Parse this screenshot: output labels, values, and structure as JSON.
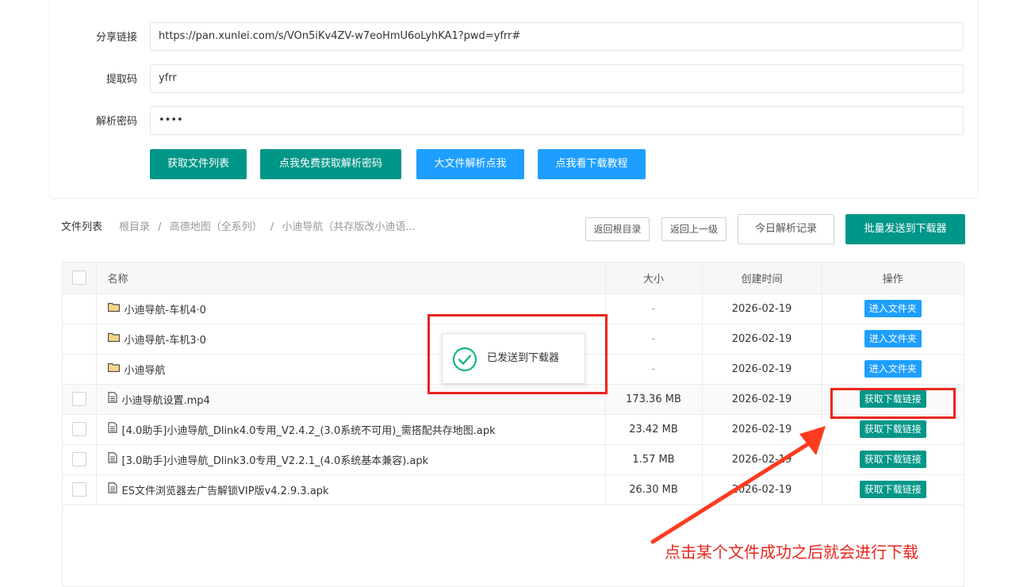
{
  "form": {
    "share_link_label": "分享链接",
    "share_link_value": "https://pan.xunlei.com/s/VOn5iKv4ZV-w7eoHmU6oLyhKA1?pwd=yfrr#",
    "extract_code_label": "提取码",
    "extract_code_value": "yfrr",
    "parse_password_label": "解析密码",
    "parse_password_value": "••••"
  },
  "buttons": {
    "get_file_list": "获取文件列表",
    "get_free_password": "点我免费获取解析密码",
    "large_file_parse": "大文件解析点我",
    "download_tutorial": "点我看下载教程"
  },
  "breadcrumb": {
    "title": "文件列表",
    "root": "根目录",
    "sep": "/",
    "level1": "高德地图（全系列）",
    "level2": "小迪导航（共存版改小迪语..."
  },
  "toolbar": {
    "back_root": "返回根目录",
    "back_up": "返回上一级",
    "today_records": "今日解析记录",
    "batch_send": "批量发送到下载器"
  },
  "table": {
    "headers": {
      "name": "名称",
      "size": "大小",
      "created": "创建时间",
      "action": "操作"
    },
    "rows": [
      {
        "name": "小迪导航-车机4·0",
        "size": "-",
        "date": "2026-02-19",
        "action": "进入文件夹"
      },
      {
        "name": "小迪导航-车机3·0",
        "size": "-",
        "date": "2026-02-19",
        "action": "进入文件夹"
      },
      {
        "name": "小迪导航",
        "size": "-",
        "date": "2026-02-19",
        "action": "进入文件夹"
      },
      {
        "name": "小迪导航设置.mp4",
        "size": "173.36 MB",
        "date": "2026-02-19",
        "action": "获取下载链接"
      },
      {
        "name": "[4.0助手]小迪导航_Dlink4.0专用_V2.4.2_(3.0系统不可用)_需搭配共存地图.apk",
        "size": "23.42 MB",
        "date": "2026-02-19",
        "action": "获取下载链接"
      },
      {
        "name": "[3.0助手]小迪导航_Dlink3.0专用_V2.2.1_(4.0系统基本兼容).apk",
        "size": "1.57 MB",
        "date": "2026-02-19",
        "action": "获取下载链接"
      },
      {
        "name": "ES文件浏览器去广告解锁VIP版v4.2.9.3.apk",
        "size": "26.30 MB",
        "date": "2026-02-19",
        "action": "获取下载链接"
      }
    ]
  },
  "toast": {
    "text": "已发送到下载器"
  },
  "annotation": {
    "text": "点击某个文件成功之后就会进行下载"
  }
}
